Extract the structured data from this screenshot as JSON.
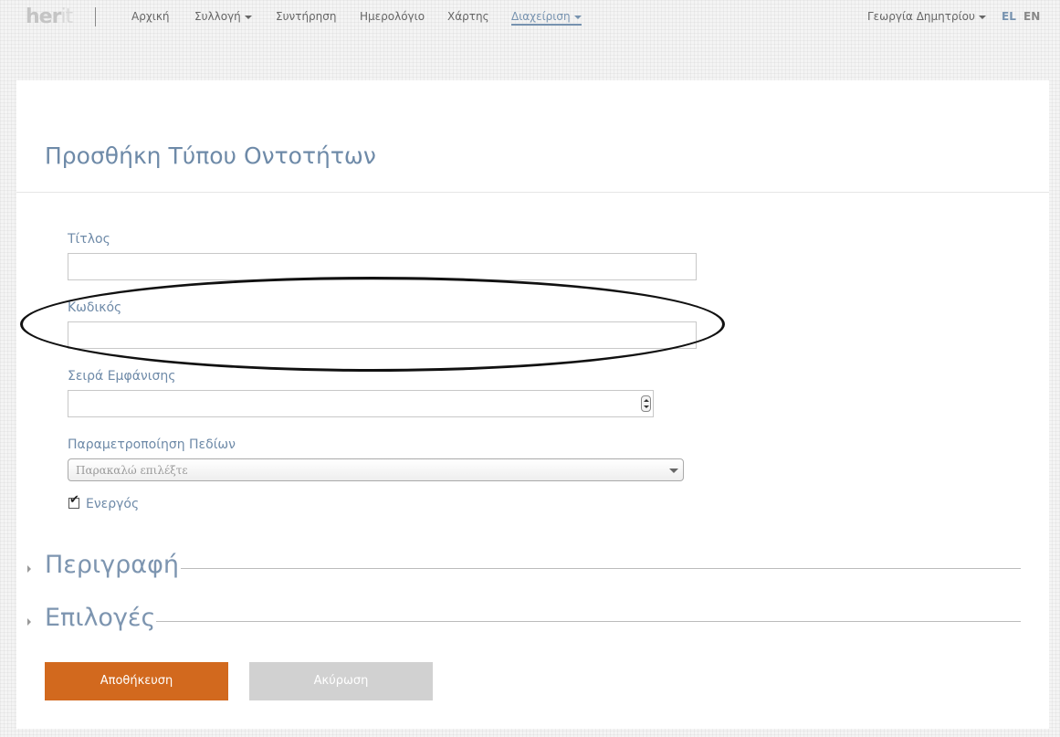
{
  "nav": {
    "logo_main": "her",
    "logo_tail": "it",
    "items": [
      {
        "label": "Αρχική",
        "dropdown": false
      },
      {
        "label": "Συλλογή",
        "dropdown": true
      },
      {
        "label": "Συντήρηση",
        "dropdown": false
      },
      {
        "label": "Ημερολόγιο",
        "dropdown": false
      },
      {
        "label": "Χάρτης",
        "dropdown": false
      },
      {
        "label": "Διαχείριση",
        "dropdown": true,
        "active": true
      }
    ],
    "user": "Γεωργία Δημητρίου",
    "languages": [
      "EL",
      "EN"
    ],
    "active_language": "EL"
  },
  "page": {
    "title": "Προσθήκη Τύπου Οντοτήτων"
  },
  "form": {
    "title_label": "Τίτλος",
    "title_value": "",
    "code_label": "Κωδικός",
    "code_value": "",
    "order_label": "Σειρά Εμφάνισης",
    "order_value": "",
    "fields_label": "Παραμετροποίηση Πεδίων",
    "fields_placeholder": "Παρακαλώ επιλέξτε",
    "active_label": "Ενεργός",
    "active_checked": true
  },
  "sections": [
    {
      "label": "Περιγραφή",
      "expanded": false
    },
    {
      "label": "Επιλογές",
      "expanded": false
    }
  ],
  "buttons": {
    "save": "Αποθήκευση",
    "cancel": "Ακύρωση"
  },
  "colors": {
    "accent": "#7793b0",
    "save_button": "#d2691e",
    "cancel_button": "#d1d1d1"
  }
}
